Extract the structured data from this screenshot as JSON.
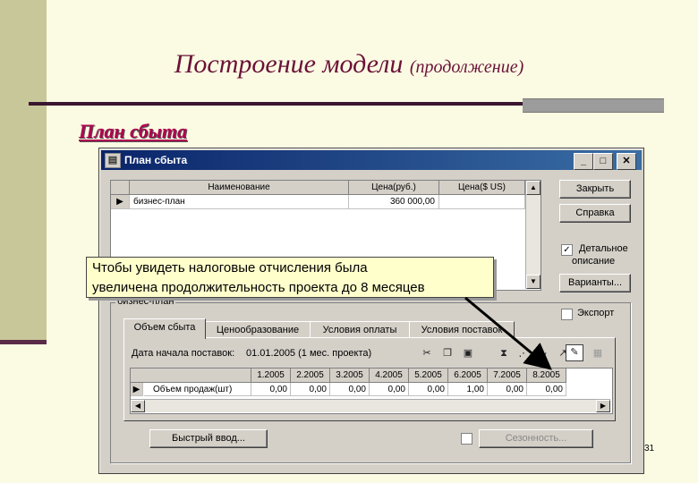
{
  "slide": {
    "title": "Построение модели",
    "title_sub": "(продолжение)",
    "heading": "План сбыта",
    "page_number": "31"
  },
  "window": {
    "title": "План сбыта",
    "buttons": {
      "close": "Закрыть",
      "help": "Справка",
      "variants": "Варианты...",
      "quick_input": "Быстрый ввод...",
      "seasonality": "Сезонность..."
    },
    "checkboxes": {
      "detailed_label_1": "Детальное",
      "detailed_label_2": "описание",
      "detailed_checked": "✓",
      "export_label": "Экспорт"
    },
    "top_grid": {
      "columns": [
        "Наименование",
        "Цена(руб.)",
        "Цена($ US)"
      ],
      "row": {
        "name": "бизнес-план",
        "price_rub": "360 000,00",
        "price_usd": ""
      }
    },
    "group_label": "бизнес-план",
    "tabs": [
      "Объем сбыта",
      "Ценообразование",
      "Условия оплаты",
      "Условия поставок"
    ],
    "start_date_label": "Дата начала поставок:",
    "start_date_value": "01.01.2005 (1 мес. проекта)",
    "bottom_grid": {
      "months": [
        "1.2005",
        "2.2005",
        "3.2005",
        "4.2005",
        "5.2005",
        "6.2005",
        "7.2005",
        "8.2005"
      ],
      "row_label": "Объем продаж(шт)",
      "values": [
        "0,00",
        "0,00",
        "0,00",
        "0,00",
        "0,00",
        "1,00",
        "0,00",
        "0,00"
      ]
    }
  },
  "callout": {
    "line1": "Чтобы увидеть налоговые отчисления была",
    "line2": "увеличена продолжительность проекта до 8 месяцев"
  }
}
